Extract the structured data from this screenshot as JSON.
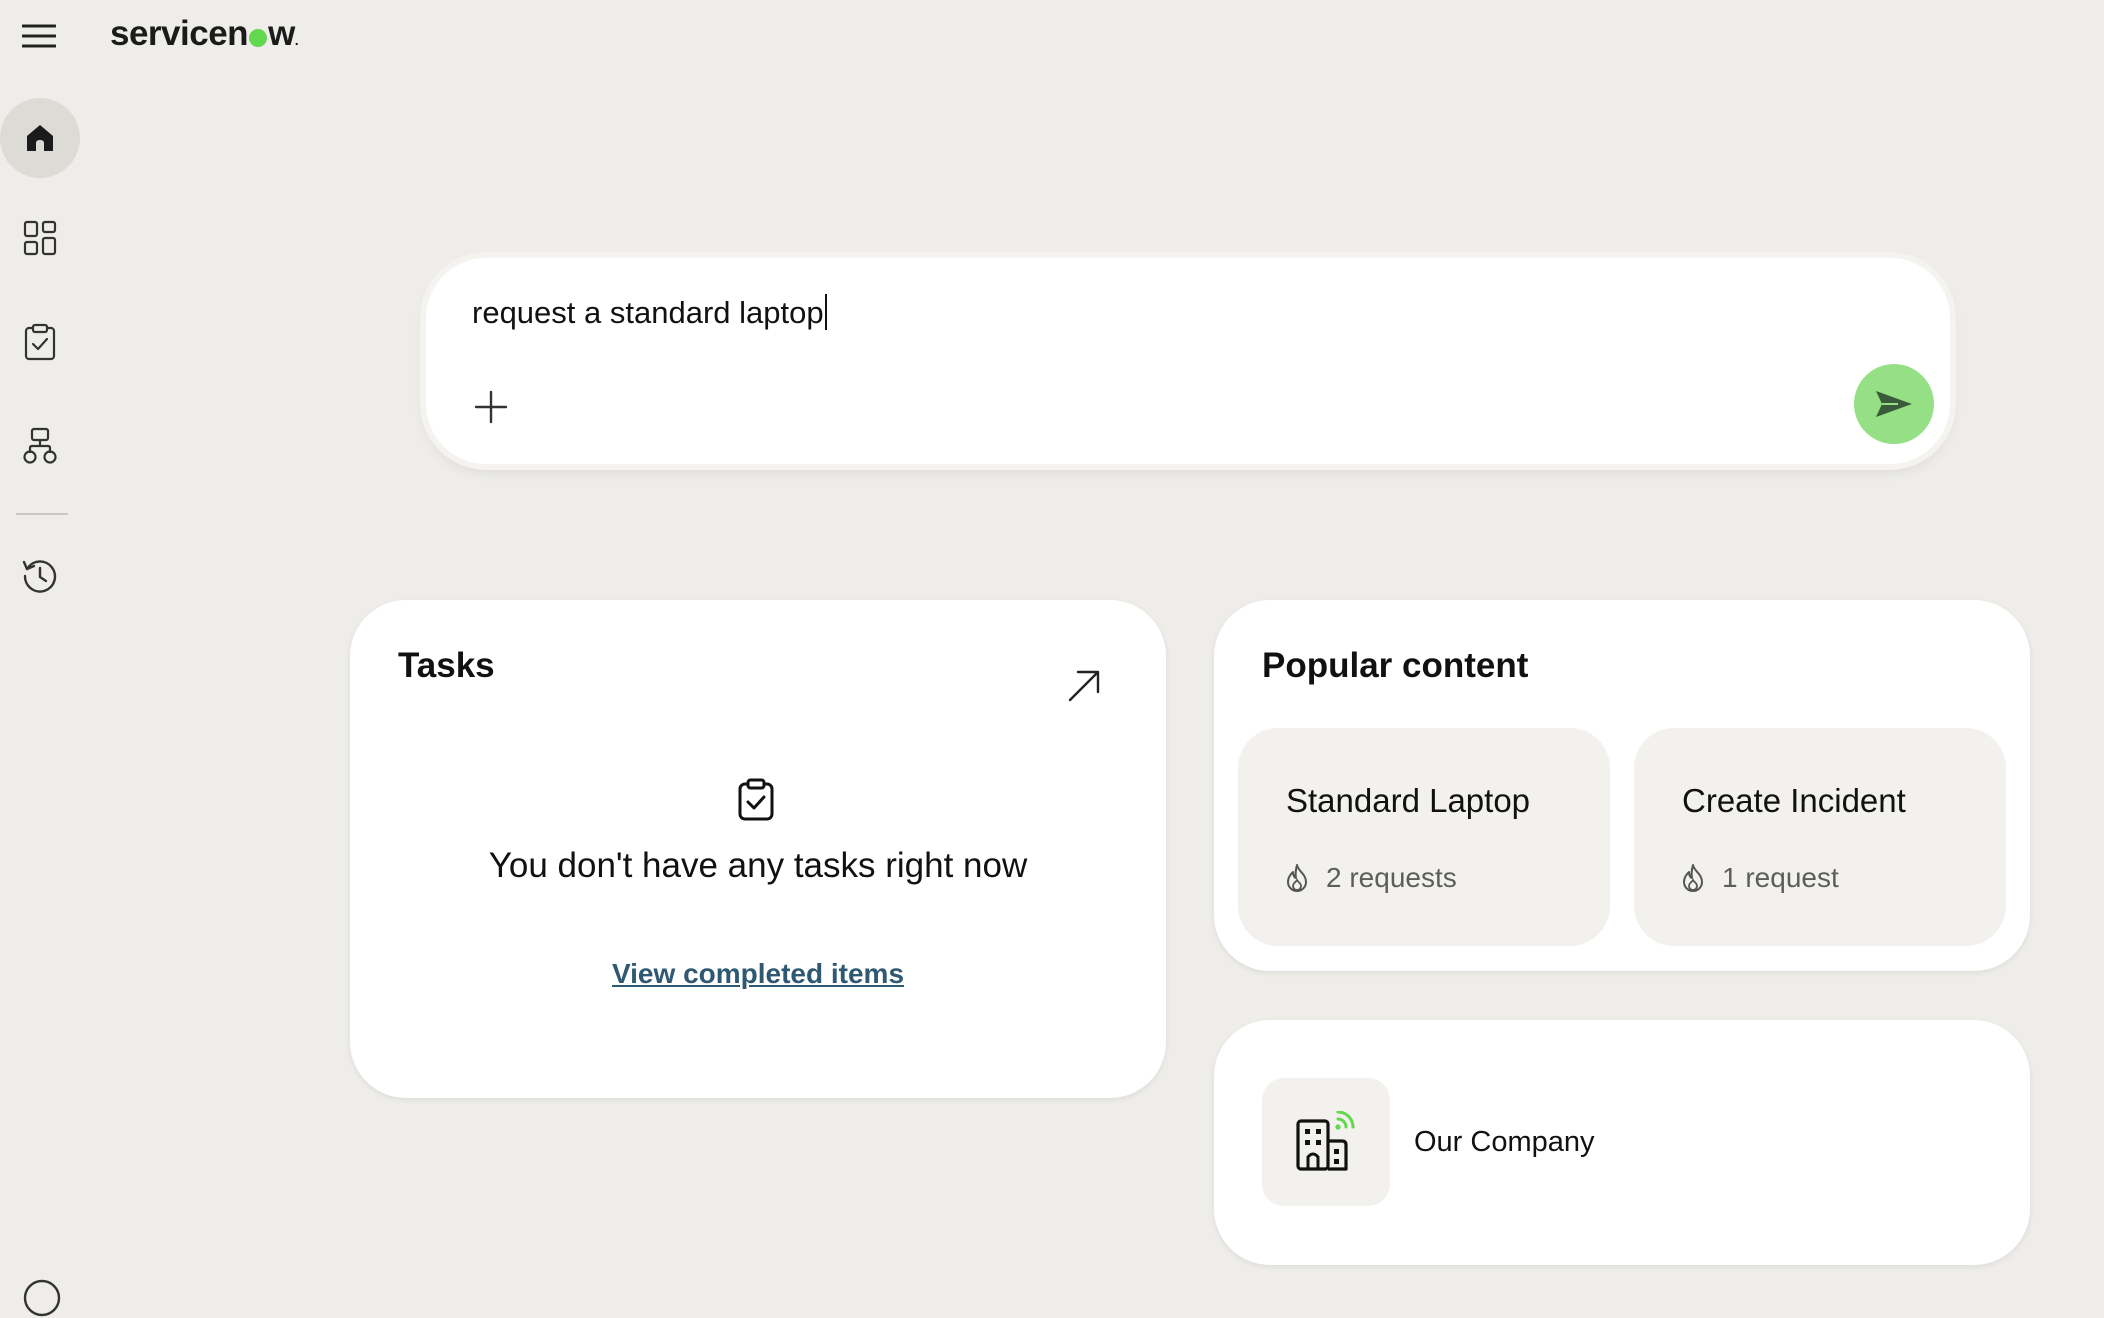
{
  "app": {
    "logo_text_left": "servicen",
    "logo_text_right": "w",
    "logo_tm": ".",
    "brand_color": "#62d84e"
  },
  "rail": {
    "items": [
      {
        "name": "home",
        "icon": "home-icon",
        "active": true
      },
      {
        "name": "apps",
        "icon": "apps-grid-icon",
        "active": false
      },
      {
        "name": "tasks",
        "icon": "clipboard-check-icon",
        "active": false
      },
      {
        "name": "workflows",
        "icon": "workflow-icon",
        "active": false
      },
      {
        "name": "history",
        "icon": "history-icon",
        "active": false
      }
    ]
  },
  "prompt": {
    "value": "request a standard laptop",
    "attach_icon": "plus-icon",
    "send_icon": "send-icon"
  },
  "tasks": {
    "title": "Tasks",
    "empty_message": "You don't have any tasks right now",
    "link": "View completed items"
  },
  "popular": {
    "title": "Popular content",
    "items": [
      {
        "title": "Standard Laptop",
        "meta": "2 requests",
        "icon": "flame-icon"
      },
      {
        "title": "Create Incident",
        "meta": "1 request",
        "icon": "flame-icon"
      }
    ]
  },
  "company": {
    "label": "Our Company",
    "icon": "building-wifi-icon"
  }
}
